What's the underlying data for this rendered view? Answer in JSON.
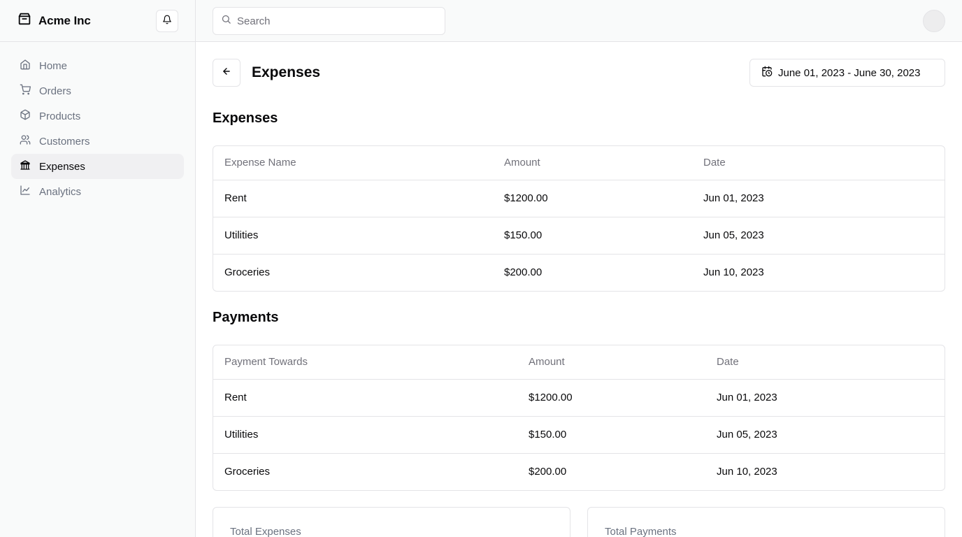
{
  "sidebar": {
    "brand": "Acme Inc",
    "items": [
      {
        "label": "Home",
        "icon": "home-icon"
      },
      {
        "label": "Orders",
        "icon": "cart-icon"
      },
      {
        "label": "Products",
        "icon": "package-icon"
      },
      {
        "label": "Customers",
        "icon": "users-icon"
      },
      {
        "label": "Expenses",
        "icon": "bank-icon",
        "active": true
      },
      {
        "label": "Analytics",
        "icon": "line-chart-icon"
      }
    ]
  },
  "header": {
    "search_placeholder": "Search"
  },
  "page": {
    "title": "Expenses",
    "date_range": "June 01, 2023 - June 30, 2023"
  },
  "expenses": {
    "title": "Expenses",
    "columns": [
      "Expense Name",
      "Amount",
      "Date"
    ],
    "rows": [
      [
        "Rent",
        "$1200.00",
        "Jun 01, 2023"
      ],
      [
        "Utilities",
        "$150.00",
        "Jun 05, 2023"
      ],
      [
        "Groceries",
        "$200.00",
        "Jun 10, 2023"
      ]
    ]
  },
  "payments": {
    "title": "Payments",
    "columns": [
      "Payment Towards",
      "Amount",
      "Date"
    ],
    "rows": [
      [
        "Rent",
        "$1200.00",
        "Jun 01, 2023"
      ],
      [
        "Utilities",
        "$150.00",
        "Jun 05, 2023"
      ],
      [
        "Groceries",
        "$200.00",
        "Jun 10, 2023"
      ]
    ]
  },
  "summary": {
    "total_expenses_label": "Total Expenses",
    "total_payments_label": "Total Payments"
  },
  "colors": {
    "border": "#e4e4e7",
    "sidebar_bg": "#f9fafa",
    "muted_text": "#71717a",
    "active_bg": "#f0f0f2"
  }
}
